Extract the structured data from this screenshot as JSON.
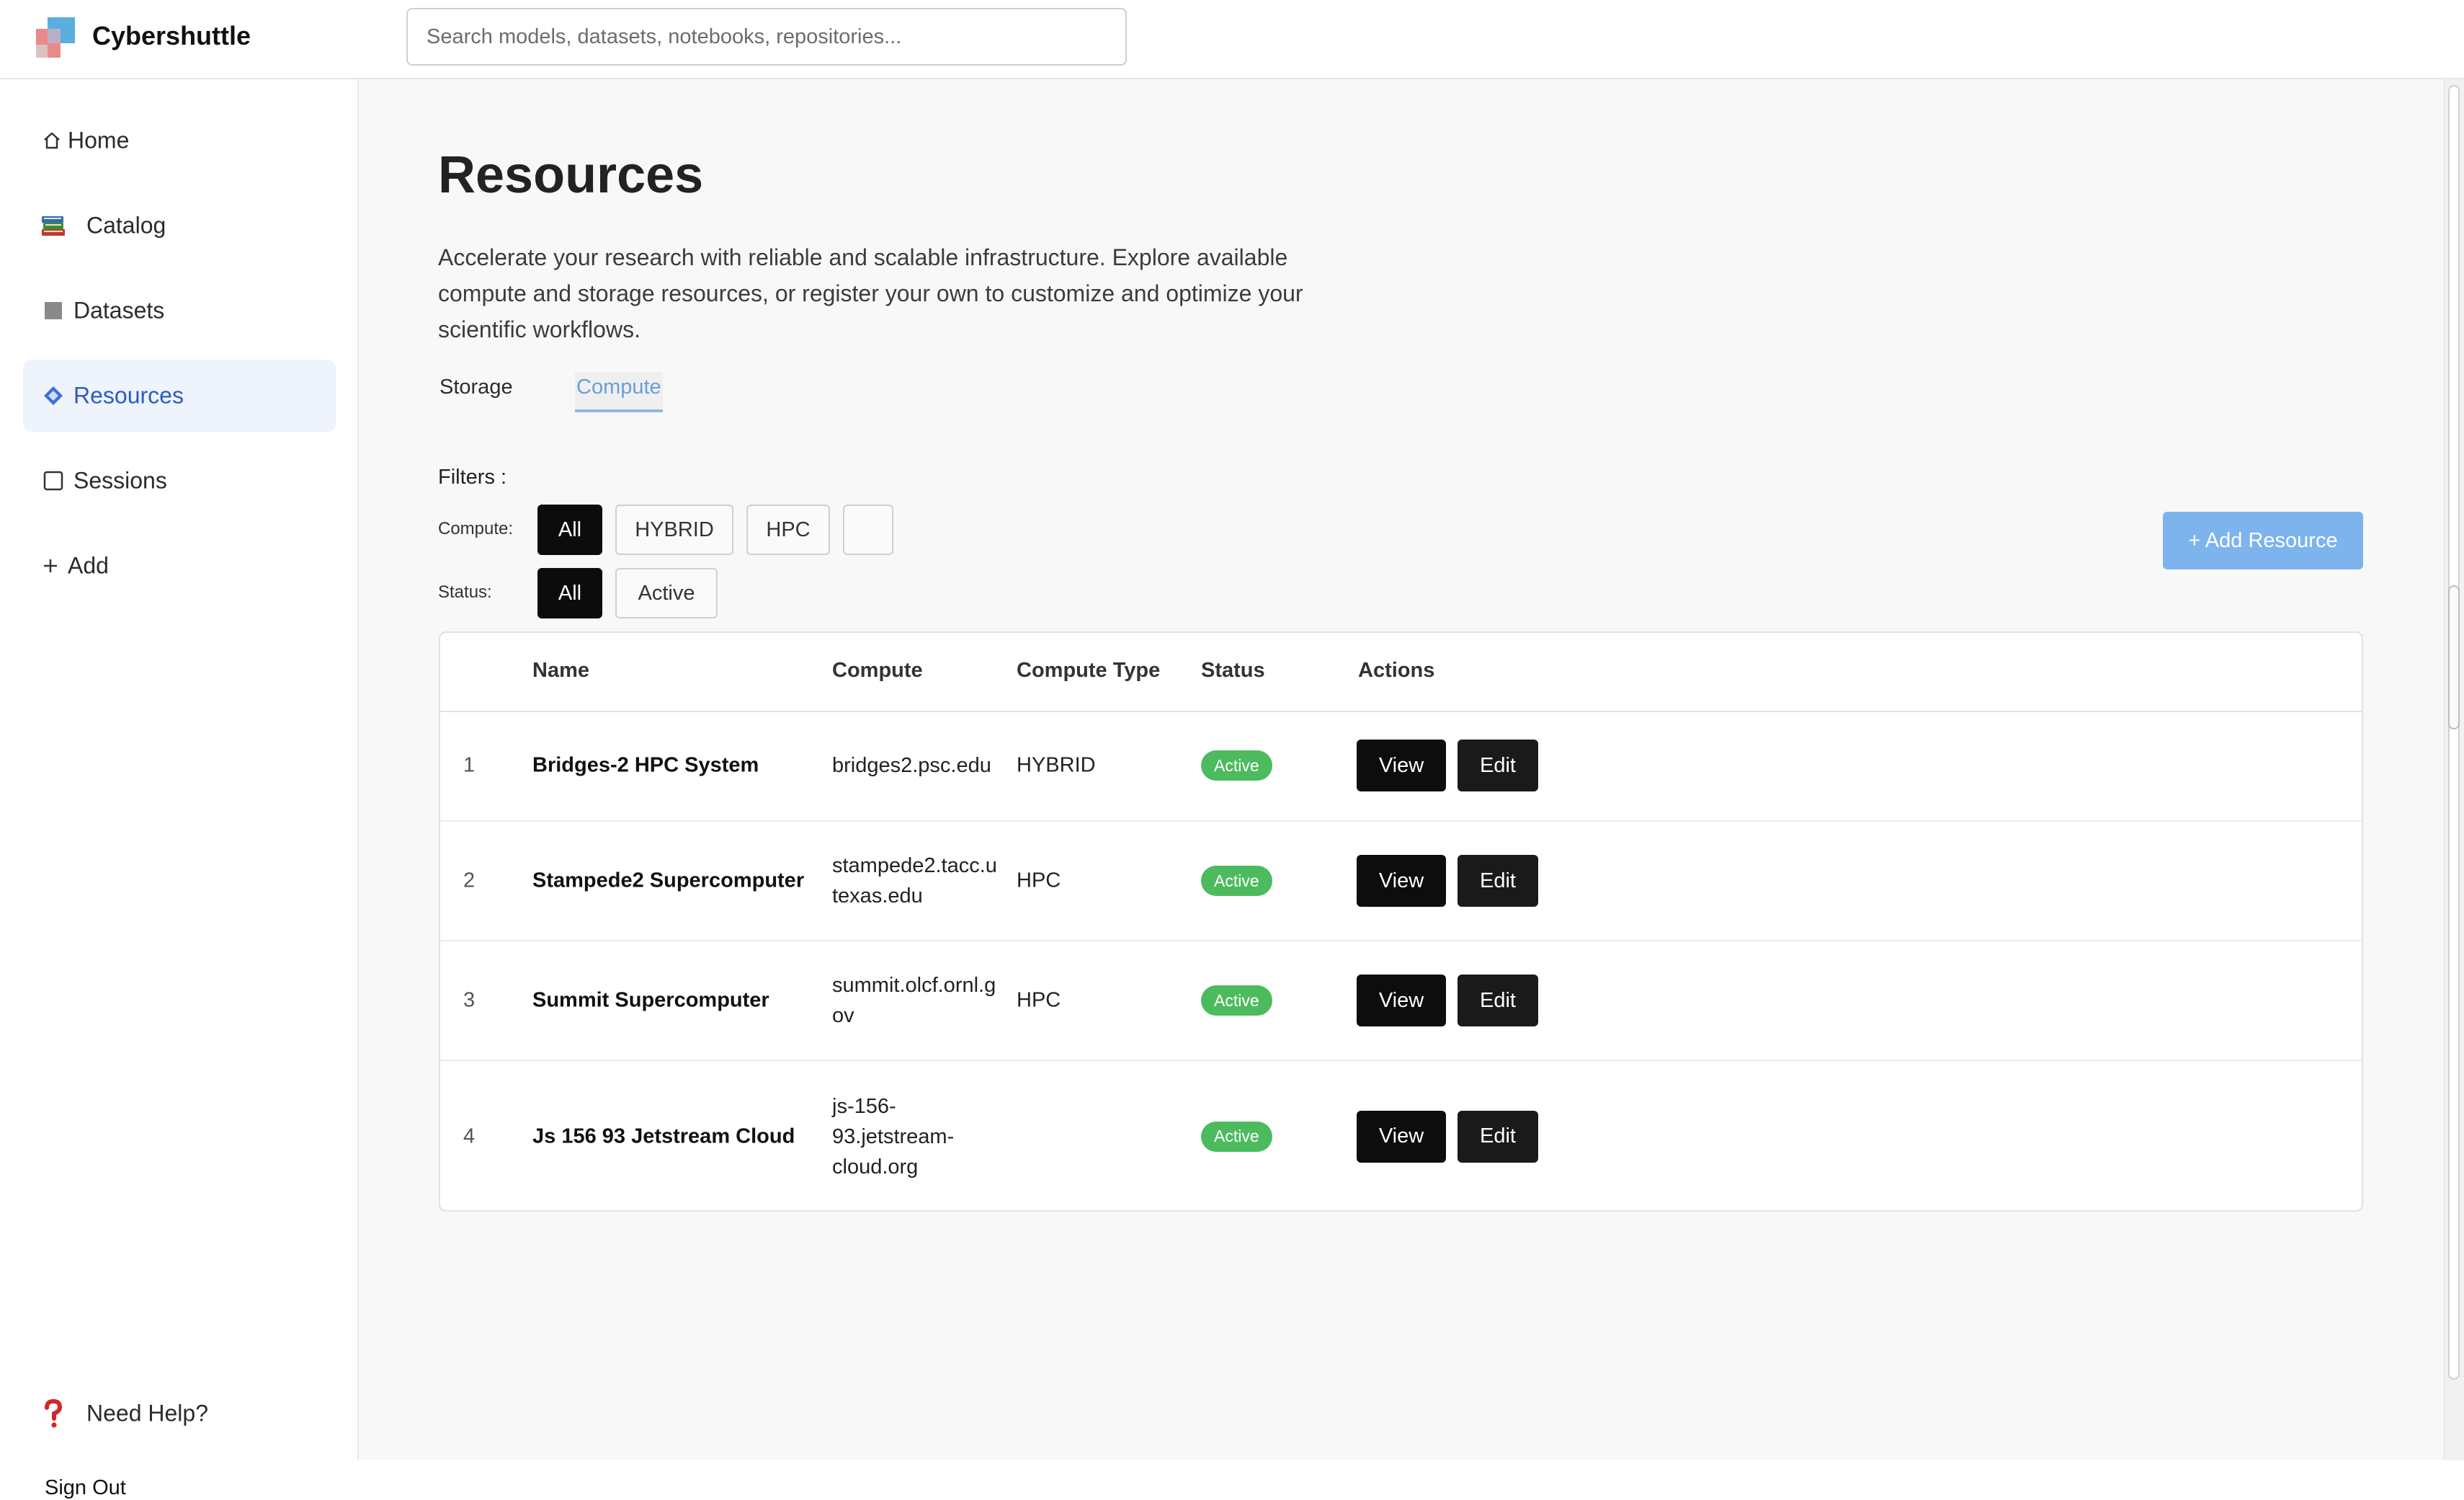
{
  "app": {
    "brand": "Cybershuttle"
  },
  "search": {
    "placeholder": "Search models, datasets, notebooks, repositories..."
  },
  "sidebar": {
    "items": [
      {
        "label": "Home",
        "icon": "home-icon",
        "active": false
      },
      {
        "label": "Catalog",
        "icon": "books-icon",
        "active": false
      },
      {
        "label": "Datasets",
        "icon": "square-filled-icon",
        "active": false
      },
      {
        "label": "Resources",
        "icon": "diamond-icon",
        "active": true
      },
      {
        "label": "Sessions",
        "icon": "square-outline-icon",
        "active": false
      },
      {
        "label": "Add",
        "icon": "plus-icon",
        "active": false
      }
    ],
    "help": "Need Help?",
    "signout": "Sign Out"
  },
  "page": {
    "title": "Resources",
    "description": "Accelerate your research with reliable and scalable infrastructure. Explore available compute and storage resources, or register your own to customize and optimize your scientific workflows.",
    "tabs": {
      "storage": "Storage",
      "compute": "Compute"
    },
    "active_tab": "Compute",
    "filters_label": "Filters :",
    "compute_label": "Compute:",
    "status_label": "Status:",
    "compute_filters": [
      "All",
      "HYBRID",
      "HPC",
      ""
    ],
    "status_filters": [
      "All",
      "Active"
    ],
    "add_button": "+ Add Resource"
  },
  "table": {
    "headers": {
      "name": "Name",
      "compute": "Compute",
      "compute_type": "Compute Type",
      "status": "Status",
      "actions": "Actions"
    },
    "rows": [
      {
        "index": "1",
        "name": "Bridges-2 HPC System",
        "compute": "bridges2.psc.edu",
        "compute_type": "HYBRID",
        "status": "Active"
      },
      {
        "index": "2",
        "name": "Stampede2 Supercomputer",
        "compute": "stampede2.tacc.utexas.edu",
        "compute_type": "HPC",
        "status": "Active"
      },
      {
        "index": "3",
        "name": "Summit Supercomputer",
        "compute": "summit.olcf.ornl.gov",
        "compute_type": "HPC",
        "status": "Active"
      },
      {
        "index": "4",
        "name": "Js 156 93 Jetstream Cloud",
        "compute": "js-156-93.jetstream-cloud.org",
        "compute_type": "",
        "status": "Active"
      }
    ],
    "view_label": "View",
    "edit_label": "Edit"
  },
  "colors": {
    "accent": "#2d5bc4",
    "active_nav_bg": "#eef3fc",
    "add_button": "#7db4ee",
    "status_active": "#4cbb5e",
    "tab_active": "#6a9fd8"
  }
}
